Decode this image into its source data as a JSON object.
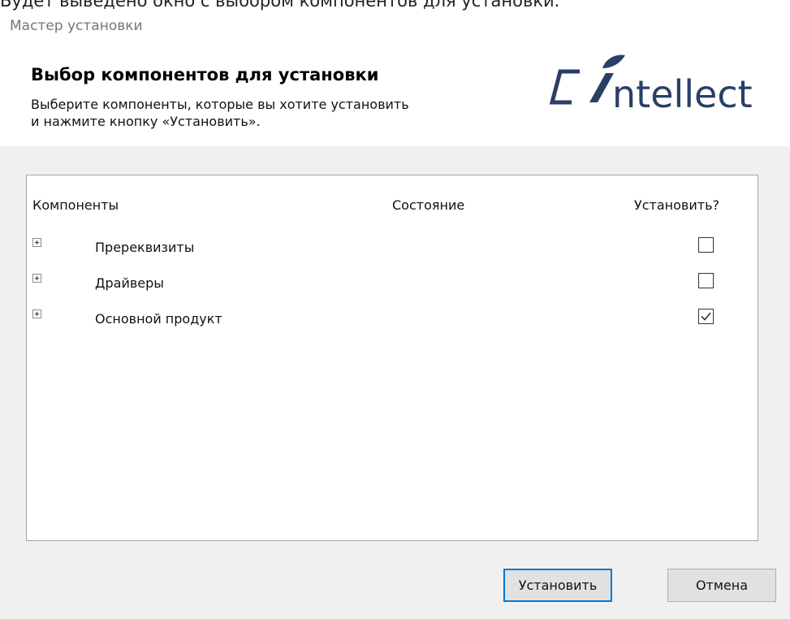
{
  "doc_caption": "Будет выведено окно с выбором компонентов для установки.",
  "window": {
    "title": "Мастер установки"
  },
  "header": {
    "title": "Выбор компонентов для установки",
    "description_line1": "Выберите компоненты, которые вы хотите установить",
    "description_line2": "и нажмите кнопку «Установить».",
    "logo_text": "ntellect",
    "logo_color": "#2a3f66"
  },
  "table": {
    "columns": {
      "components": "Компоненты",
      "state": "Состояние",
      "install": "Установить?"
    },
    "rows": [
      {
        "label": "Пререквизиты",
        "state": "",
        "checked": false,
        "expander_icon": "plus-box-icon"
      },
      {
        "label": "Драйверы",
        "state": "",
        "checked": false,
        "expander_icon": "plus-box-icon"
      },
      {
        "label": "Основной продукт",
        "state": "",
        "checked": true,
        "expander_icon": "plus-box-icon"
      }
    ]
  },
  "buttons": {
    "install_label": "Установить",
    "cancel_label": "Отмена",
    "focus_color": "#0078d7"
  }
}
